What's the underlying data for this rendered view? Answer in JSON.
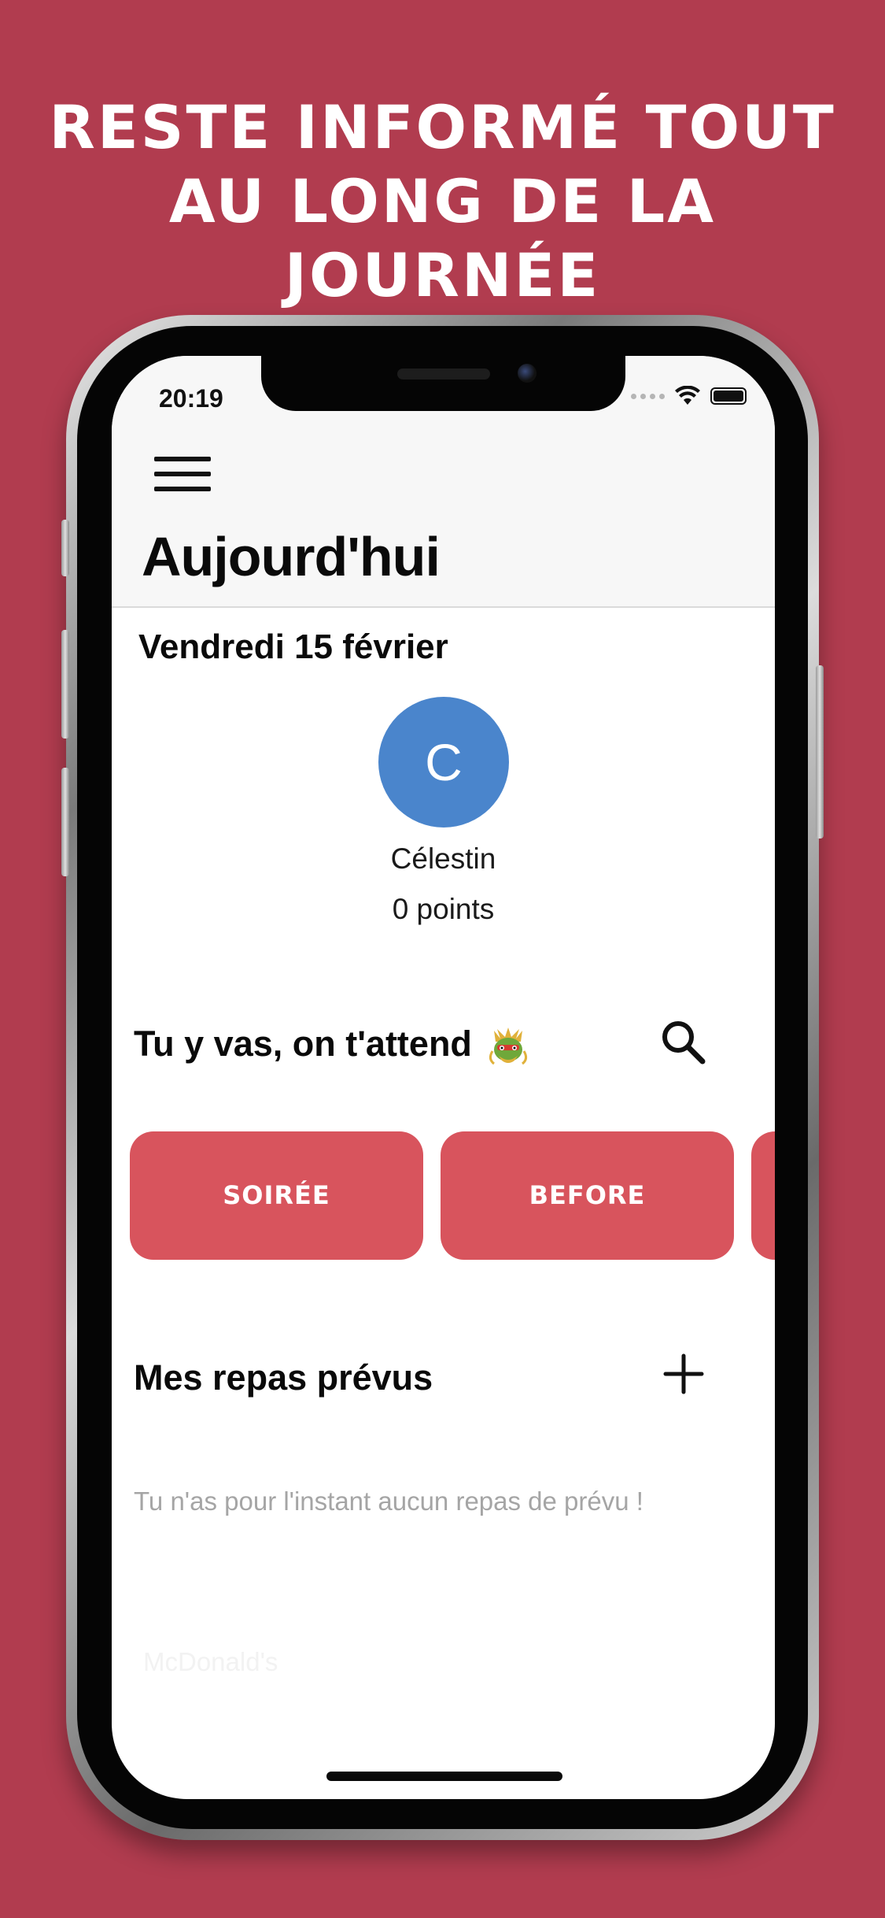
{
  "headline": {
    "line1": "Reste informé tout",
    "line2": "au long de la journée"
  },
  "status_bar": {
    "time": "20:19"
  },
  "header": {
    "menu_icon": "hamburger-menu-icon",
    "title": "Aujourd'hui"
  },
  "profile": {
    "date": "Vendredi 15 février",
    "avatar_initial": "C",
    "name": "Célestin",
    "points": "0 points"
  },
  "events_section": {
    "title": "Tu y vas, on t'attend",
    "title_emoji_icon": "dragon-emoji-icon",
    "search_icon": "search-icon",
    "chips": [
      {
        "label": "Soirée"
      },
      {
        "label": "Before"
      },
      {
        "label": ""
      }
    ]
  },
  "meals_section": {
    "title": "Mes repas prévus",
    "add_icon": "plus-icon",
    "empty_message": "Tu n'as pour l'instant aucun repas de prévu !",
    "ghost_item": "McDonald's"
  },
  "colors": {
    "background": "#b13c4f",
    "chip": "#d8545d",
    "avatar": "#4a85cc",
    "empty_text": "#a5a5a5"
  }
}
